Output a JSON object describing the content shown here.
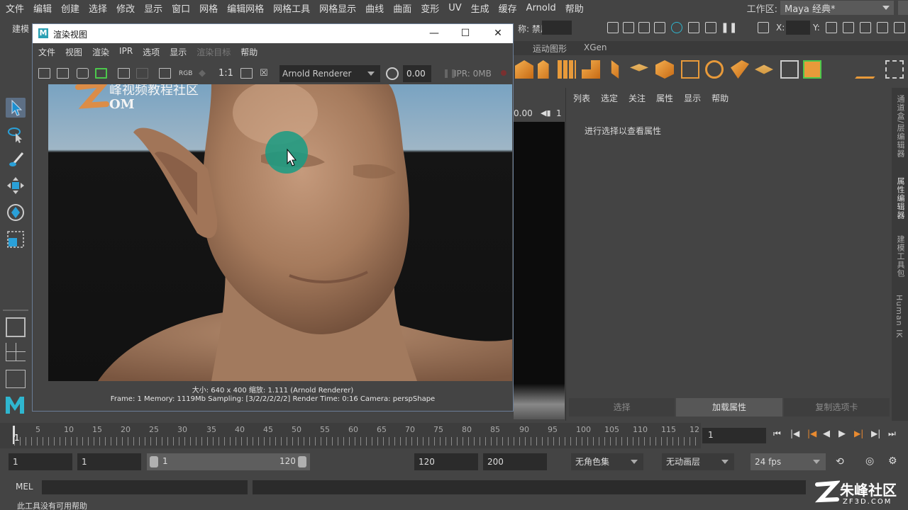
{
  "menubar": {
    "items": [
      "文件",
      "编辑",
      "创建",
      "选择",
      "修改",
      "显示",
      "窗口",
      "网格",
      "编辑网格",
      "网格工具",
      "网格显示",
      "曲线",
      "曲面",
      "变形",
      "UV",
      "生成",
      "缓存",
      "Arnold",
      "帮助"
    ],
    "workspace_label": "工作区:",
    "workspace_value": "Maya 经典*"
  },
  "statusline": {
    "mode": "建模",
    "symmetry_label": "称: 禁用",
    "x_label": "X:",
    "y_label": "Y:"
  },
  "shelf": {
    "tabs": [
      "运动图形",
      "XGen"
    ]
  },
  "viewport": {
    "readout": "0.00",
    "readout2": "1"
  },
  "render_view": {
    "title": "渲染视图",
    "menu": [
      "文件",
      "视图",
      "渲染",
      "IPR",
      "选项",
      "显示",
      "渲染目标",
      "帮助"
    ],
    "ratio_label": "1:1",
    "rgb_label": "RGB",
    "renderer": "Arnold Renderer",
    "exposure": "0.00",
    "ipr_memory": "IPR: 0MB",
    "watermark_text": "峰视频教程社区",
    "watermark_sub": "OM",
    "info_line1": "大小: 640 x 400 缩放: 1.111    (Arnold Renderer)",
    "info_line2": "Frame: 1     Memory: 1119Mb     Sampling: [3/2/2/2/2/2]     Render Time: 0:16     Camera: perspShape"
  },
  "attribute_editor": {
    "menu": [
      "列表",
      "选定",
      "关注",
      "属性",
      "显示",
      "帮助"
    ],
    "hint": "进行选择以查看属性",
    "buttons": [
      "选择",
      "加载属性",
      "复制选项卡"
    ]
  },
  "side_tabs": [
    "通道盒/层编辑器",
    "属性编辑器",
    "建模工具包",
    "Human IK"
  ],
  "timeslider": {
    "ticks": [
      "5",
      "10",
      "15",
      "20",
      "25",
      "30",
      "35",
      "40",
      "45",
      "50",
      "55",
      "60",
      "65",
      "70",
      "75",
      "80",
      "85",
      "90",
      "95",
      "100",
      "105",
      "110",
      "115",
      "12"
    ],
    "start_tick": "1",
    "current_frame": "1"
  },
  "range": {
    "start": "1",
    "playback_start": "1",
    "slider_start": "1",
    "slider_end": "120",
    "playback_end": "120",
    "end": "200",
    "char_set": "无角色集",
    "anim_layer": "无动画层",
    "fps": "24 fps"
  },
  "cmdline": {
    "label": "MEL",
    "help": "此工具没有可用帮助"
  },
  "brand_watermark": {
    "name": "朱峰社区",
    "url": "ZF3D.COM"
  }
}
